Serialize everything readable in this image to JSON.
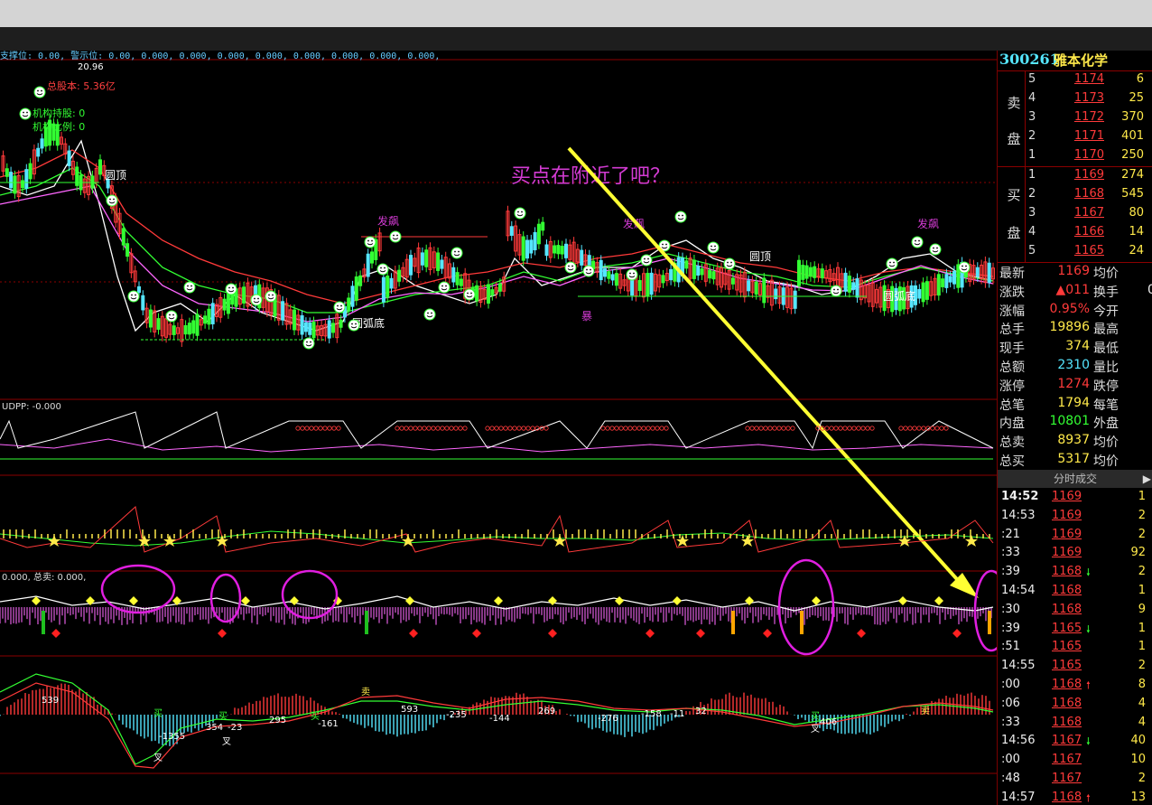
{
  "stock": {
    "code": "300261",
    "name": "雅本化学"
  },
  "main_chart": {
    "header": "支撑位: 0.00, 警示位: 0.00, 0.000, 0.000, 0.000, 0.000, 0.000, 0.000, 0.000, 0.000,",
    "high_price": "20.96",
    "total_equity": "总股本: 5.36亿",
    "inst_holding": "机构持股: 0",
    "inst_ratio": "机构比例: 0",
    "annotation": "买点在附近了吧？",
    "labels": [
      "圆顶",
      "发飙",
      "发飙",
      "发飙",
      "圆弧底",
      "圆顶",
      "圆弧底",
      "暴"
    ]
  },
  "udpp": {
    "header": "UDPP: -0.000"
  },
  "panel4": {
    "header": "0.000, 总卖: 0.000,"
  },
  "order_book": {
    "sell_label_1": "卖",
    "sell_label_2": "盘",
    "buy_label_1": "买",
    "buy_label_2": "盘",
    "sell": [
      {
        "level": "5",
        "price": "1174",
        "vol": "6"
      },
      {
        "level": "4",
        "price": "1173",
        "vol": "25"
      },
      {
        "level": "3",
        "price": "1172",
        "vol": "370"
      },
      {
        "level": "2",
        "price": "1171",
        "vol": "401"
      },
      {
        "level": "1",
        "price": "1170",
        "vol": "250"
      }
    ],
    "buy": [
      {
        "level": "1",
        "price": "1169",
        "vol": "274"
      },
      {
        "level": "2",
        "price": "1168",
        "vol": "545"
      },
      {
        "level": "3",
        "price": "1167",
        "vol": "80"
      },
      {
        "level": "4",
        "price": "1166",
        "vol": "14"
      },
      {
        "level": "5",
        "price": "1165",
        "vol": "24"
      }
    ]
  },
  "quote": [
    {
      "k1": "最新",
      "v1": "1169",
      "c1": "red",
      "k2": "均价",
      "v2": ""
    },
    {
      "k1": "涨跌",
      "v1": "▲011",
      "c1": "red",
      "k2": "换手",
      "v2": "0."
    },
    {
      "k1": "涨幅",
      "v1": "0.95%",
      "c1": "red",
      "k2": "今开",
      "v2": ""
    },
    {
      "k1": "总手",
      "v1": "19896",
      "c1": "yellow",
      "k2": "最高",
      "v2": ""
    },
    {
      "k1": "现手",
      "v1": "374",
      "c1": "yellow",
      "k2": "最低",
      "v2": ""
    },
    {
      "k1": "总额",
      "v1": "2310",
      "c1": "cyan",
      "k2": "量比",
      "v2": ""
    },
    {
      "k1": "涨停",
      "v1": "1274",
      "c1": "red",
      "k2": "跌停",
      "v2": ""
    },
    {
      "k1": "总笔",
      "v1": "1794",
      "c1": "yellow",
      "k2": "每笔",
      "v2": ""
    },
    {
      "k1": "内盘",
      "v1": "10801",
      "c1": "green",
      "k2": "外盘",
      "v2": ""
    },
    {
      "k1": "总卖",
      "v1": "8937",
      "c1": "yellow",
      "k2": "均价",
      "v2": ""
    },
    {
      "k1": "总买",
      "v1": "5317",
      "c1": "yellow",
      "k2": "均价",
      "v2": ""
    }
  ],
  "ticks_header": "分时成交",
  "ticks": [
    {
      "t": "14:52",
      "p": "1169",
      "a": "",
      "v": "1"
    },
    {
      "t": "14:53",
      "p": "1169",
      "a": "",
      "v": "2"
    },
    {
      "t": ":21",
      "p": "1169",
      "a": "",
      "v": "2"
    },
    {
      "t": ":33",
      "p": "1169",
      "a": "",
      "v": "92"
    },
    {
      "t": ":39",
      "p": "1168",
      "a": "down",
      "v": "2"
    },
    {
      "t": "14:54",
      "p": "1168",
      "a": "",
      "v": "1"
    },
    {
      "t": ":30",
      "p": "1168",
      "a": "",
      "v": "9"
    },
    {
      "t": ":39",
      "p": "1165",
      "a": "down",
      "v": "1"
    },
    {
      "t": ":51",
      "p": "1165",
      "a": "",
      "v": "1"
    },
    {
      "t": "14:55",
      "p": "1165",
      "a": "",
      "v": "2"
    },
    {
      "t": ":00",
      "p": "1168",
      "a": "up",
      "v": "8"
    },
    {
      "t": ":06",
      "p": "1168",
      "a": "",
      "v": "4"
    },
    {
      "t": ":33",
      "p": "1168",
      "a": "",
      "v": "4"
    },
    {
      "t": "14:56",
      "p": "1167",
      "a": "down",
      "v": "40"
    },
    {
      "t": ":00",
      "p": "1167",
      "a": "",
      "v": "10"
    },
    {
      "t": ":48",
      "p": "1167",
      "a": "",
      "v": "2"
    },
    {
      "t": "14:57",
      "p": "1168",
      "a": "up",
      "v": "13"
    }
  ],
  "macd": {
    "values": [
      "539",
      "-1355",
      "354",
      "-23",
      "295",
      "-161",
      "593",
      "-235",
      "-144",
      "269",
      "-276",
      "-158",
      "-11",
      "32",
      "406"
    ],
    "buy": "买",
    "sell": "卖",
    "cross": "叉"
  },
  "colors": {
    "up": "#ff3a3a",
    "down": "#33ff33",
    "text": "#ffe94a",
    "price": "#55e6ff",
    "annotation": "#d33bd3",
    "arrow": "#ffff33"
  }
}
